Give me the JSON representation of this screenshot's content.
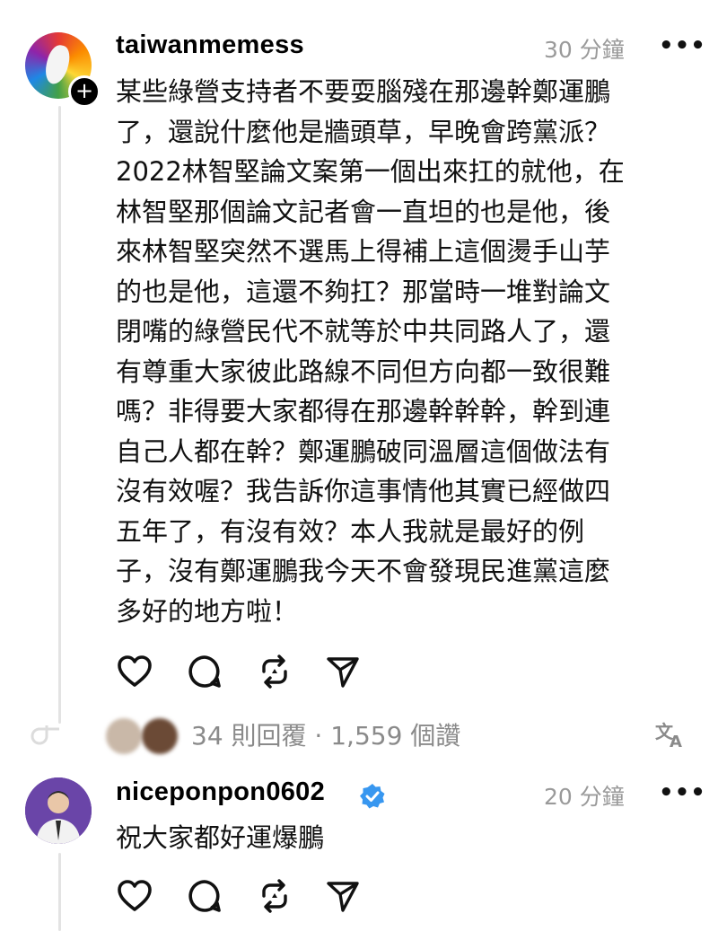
{
  "post": {
    "username": "taiwanmemess",
    "time": "30 分鐘",
    "more": "•••",
    "text_lines": [
      "某些綠營支持者不要耍腦殘在那邊幹鄭運鵬",
      "了，還說什麼他是牆頭草，早晚會跨黨派？",
      "2022林智堅論文案第一個出來扛的就他，在",
      "林智堅那個論文記者會一直坦的也是他，後",
      "來林智堅突然不選馬上得補上這個燙手山芋",
      "的也是他，這還不夠扛？那當時一堆對論文",
      "閉嘴的綠營民代不就等於中共同路人了，還",
      "有尊重大家彼此路線不同但方向都一致很難",
      "嗎？非得要大家都得在那邊幹幹幹，幹到連",
      "自己人都在幹？鄭運鵬破同溫層這個做法有",
      "沒有效喔？我告訴你這事情他其實已經做四",
      "五年了，有沒有效？本人我就是最好的例",
      "子，沒有鄭運鵬我今天不會發現民進黨這麼",
      "多好的地方啦！"
    ],
    "stats": "34 則回覆 · 1,559 個讚",
    "translate_icon": "translate-icon"
  },
  "reply": {
    "username": "niceponpon0602",
    "time": "20 分鐘",
    "more": "•••",
    "text": "祝大家都好運爆鵬"
  },
  "icons": [
    "heart-icon",
    "comment-icon",
    "repost-icon",
    "share-icon"
  ],
  "colors": {
    "verified": "#3897f0",
    "muted": "#9a9a9a"
  }
}
